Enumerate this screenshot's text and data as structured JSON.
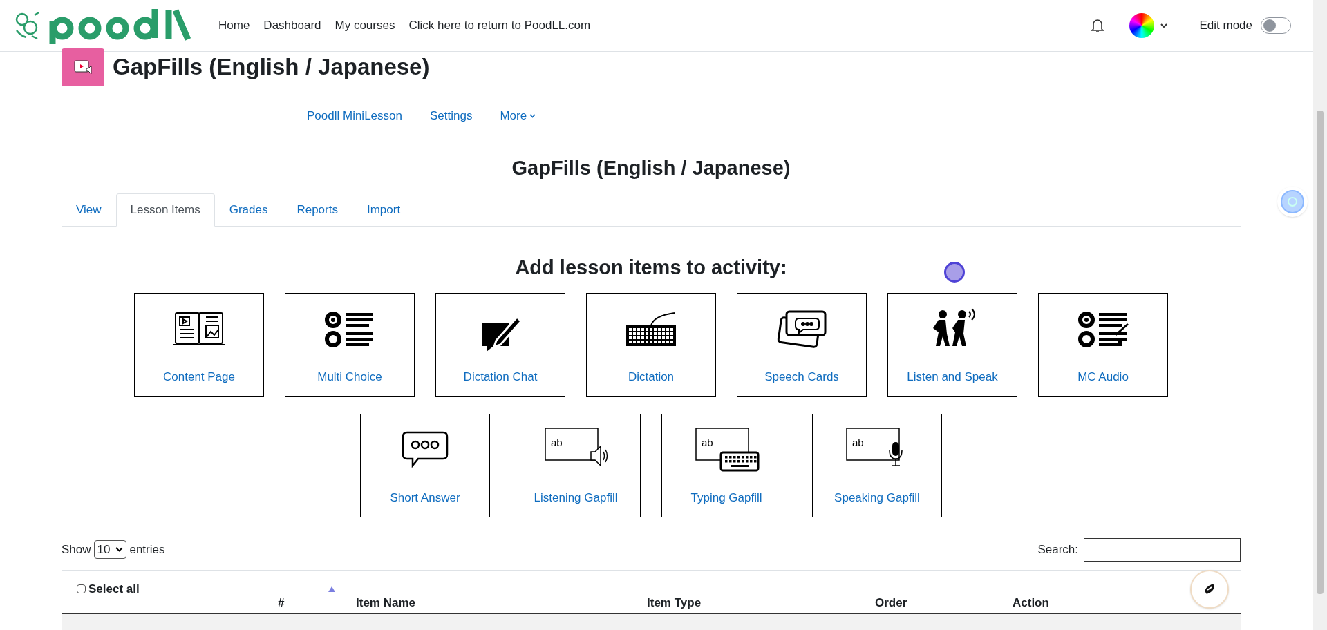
{
  "navbar": {
    "links": [
      "Home",
      "Dashboard",
      "My courses",
      "Click here to return to PoodLL.com"
    ],
    "edit_mode": {
      "label": "Edit mode",
      "on": false
    }
  },
  "page_title": "GapFills (English / Japanese)",
  "secondary_nav": [
    {
      "label": "Poodll MiniLesson",
      "kind": "link"
    },
    {
      "label": "Settings",
      "kind": "link"
    },
    {
      "label": "More",
      "kind": "menu"
    }
  ],
  "heading": "GapFills (English / Japanese)",
  "tabs": [
    {
      "label": "View",
      "selected": false
    },
    {
      "label": "Lesson Items",
      "selected": true
    },
    {
      "label": "Grades",
      "selected": false
    },
    {
      "label": "Reports",
      "selected": false
    },
    {
      "label": "Import",
      "selected": false
    }
  ],
  "add_heading": "Add lesson items to activity:",
  "item_rows": [
    [
      {
        "label": "Content Page",
        "kind": "book"
      },
      {
        "label": "Multi Choice",
        "kind": "choice"
      },
      {
        "label": "Dictation Chat",
        "kind": "chat"
      },
      {
        "label": "Dictation",
        "kind": "keyboard"
      },
      {
        "label": "Speech Cards",
        "kind": "cards"
      },
      {
        "label": "Listen and Speak",
        "kind": "people"
      },
      {
        "label": "MC Audio",
        "kind": "choice-mic"
      }
    ],
    [
      {
        "label": "Short Answer",
        "kind": "bubble"
      },
      {
        "label": "Listening Gapfill",
        "kind": "gap-speaker",
        "icon_text": "ab ___"
      },
      {
        "label": "Typing Gapfill",
        "kind": "gap-keyboard",
        "icon_text": "ab ___"
      },
      {
        "label": "Speaking Gapfill",
        "kind": "gap-mic",
        "icon_text": "ab ___"
      }
    ]
  ],
  "table_controls": {
    "show_label": "Show",
    "page_size": "10",
    "entries_label": "entries",
    "search_label": "Search:"
  },
  "table": {
    "select_all": {
      "label": "Select all",
      "checked": false
    },
    "columns": [
      "#",
      "Item Name",
      "Item Type",
      "Order",
      "Action"
    ]
  }
}
